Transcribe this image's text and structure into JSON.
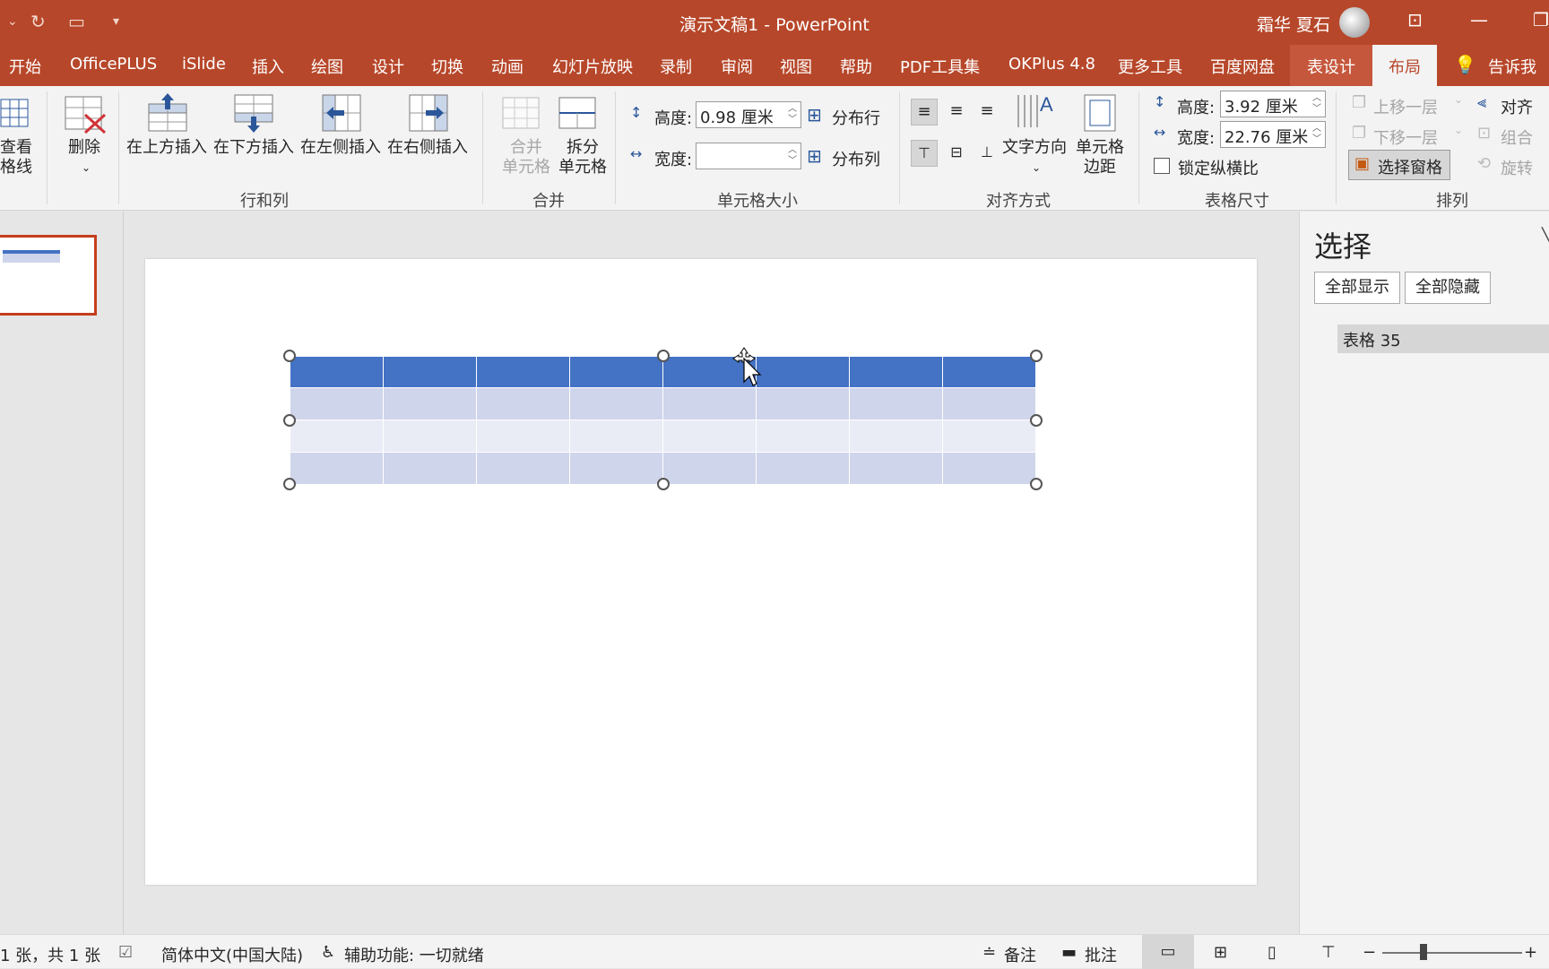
{
  "app": {
    "title": "演示文稿1  -  PowerPoint",
    "user_name": "霜华 夏石"
  },
  "tabs": [
    "开始",
    "OfficePLUS",
    "iSlide",
    "插入",
    "绘图",
    "设计",
    "切换",
    "动画",
    "幻灯片放映",
    "录制",
    "审阅",
    "视图",
    "帮助",
    "PDF工具集",
    "OKPlus 4.8",
    "更多工具",
    "百度网盘",
    "表设计",
    "布局",
    "告诉我"
  ],
  "ribbon": {
    "view_gridlines": "查看\n格线",
    "delete": "删除",
    "insert_above": "在上方插入",
    "insert_below": "在下方插入",
    "insert_left": "在左侧插入",
    "insert_right": "在右侧插入",
    "group_rows_cols": "行和列",
    "merge_cells": "合并\n单元格",
    "split_cells": "拆分\n单元格",
    "group_merge": "合并",
    "cell_height_label": "高度:",
    "cell_height_value": "0.98 厘米",
    "cell_width_label": "宽度:",
    "cell_width_value": "",
    "distribute_rows": "分布行",
    "distribute_cols": "分布列",
    "group_cell_size": "单元格大小",
    "text_direction": "文字方向",
    "cell_margins": "单元格\n边距",
    "group_alignment": "对齐方式",
    "table_height_label": "高度:",
    "table_height_value": "3.92 厘米",
    "table_width_label": "宽度:",
    "table_width_value": "22.76 厘米",
    "lock_aspect": "锁定纵横比",
    "group_table_size": "表格尺寸",
    "bring_forward": "上移一层",
    "send_backward": "下移一层",
    "selection_pane": "选择窗格",
    "align": "对齐",
    "group": "组合",
    "rotate": "旋转",
    "group_arrange": "排列"
  },
  "selection_pane": {
    "title": "选择",
    "show_all": "全部显示",
    "hide_all": "全部隐藏",
    "items": [
      "表格 35"
    ]
  },
  "table": {
    "columns": 8,
    "rows": 4
  },
  "status": {
    "slide_count": "1 张，共 1 张",
    "language": "简体中文(中国大陆)",
    "accessibility": "辅助功能: 一切就绪",
    "notes": "备注",
    "comments": "批注"
  },
  "colors": {
    "accent": "#b7472a",
    "table_header": "#4472c4",
    "table_band": "#cfd5ea"
  }
}
